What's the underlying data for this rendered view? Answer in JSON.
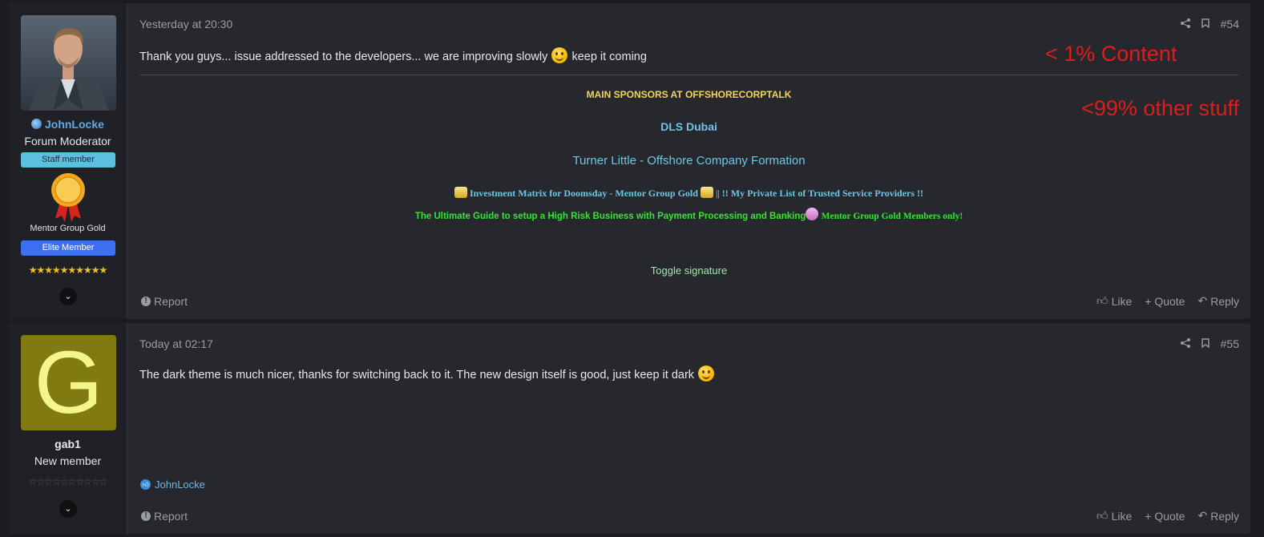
{
  "posts": [
    {
      "user": {
        "name": "JohnLocke",
        "title": "Forum Moderator",
        "staff_banner": "Staff member",
        "award": "Mentor Group Gold",
        "elite_banner": "Elite Member",
        "stars": "★★★★★★★★★★",
        "rating_stars": 10
      },
      "date": "Yesterday at 20:30",
      "number": "#54",
      "message": {
        "before": "Thank you guys... issue addressed to the developers... we are improving slowly",
        "after": "keep it coming"
      },
      "signature": {
        "sponsors_heading": "MAIN SPONSORS AT OFFSHORECORPTALK",
        "sponsor1": "DLS Dubai",
        "sponsor2": "Turner Little - Offshore Company Formation",
        "line3_a": "Investment Matrix for Doomsday - Mentor Group Gold",
        "line3_sep": "||",
        "line3_b": "!! My Private List of Trusted Service Providers !!",
        "line4_a": "The Ultimate Guide to setup a High Risk Business with Payment Processing and Banking",
        "line4_b": "Mentor Group Gold Members only!",
        "toggle": "Toggle signature"
      },
      "actions": {
        "report": "Report",
        "like": "Like",
        "quote": "+ Quote",
        "reply": "Reply"
      }
    },
    {
      "user": {
        "name": "gab1",
        "title": "New member",
        "avatar_letter": "G",
        "stars": "☆☆☆☆☆☆☆☆☆☆",
        "rating_stars": 0
      },
      "date": "Today at 02:17",
      "number": "#55",
      "message": {
        "before": "The dark theme is much nicer, thanks for switching back to it. The new design itself is good, just keep it dark"
      },
      "likes": "JohnLocke",
      "actions": {
        "report": "Report",
        "like": "Like",
        "quote": "+ Quote",
        "reply": "Reply"
      }
    }
  ],
  "annotations": {
    "content": "< 1% Content",
    "other": "<99% other stuff"
  },
  "colors": {
    "staff_banner": "#5bc0de",
    "elite_banner": "#3d6ff0",
    "username_link": "#5ea8e8",
    "annotation": "#e01b1b",
    "sponsor_heading": "#f2d35c",
    "sponsor_link": "#6ec6e4",
    "green_link": "#2ee82e",
    "gab_avatar_bg": "#807a10",
    "gab_avatar_letter": "#f4f58a"
  },
  "icons": [
    "globe-icon",
    "gold-medal-icon",
    "chevron-down-icon",
    "share-icon",
    "bookmark-icon",
    "alert-icon",
    "thumbs-up-icon",
    "reply-arrow-icon"
  ]
}
